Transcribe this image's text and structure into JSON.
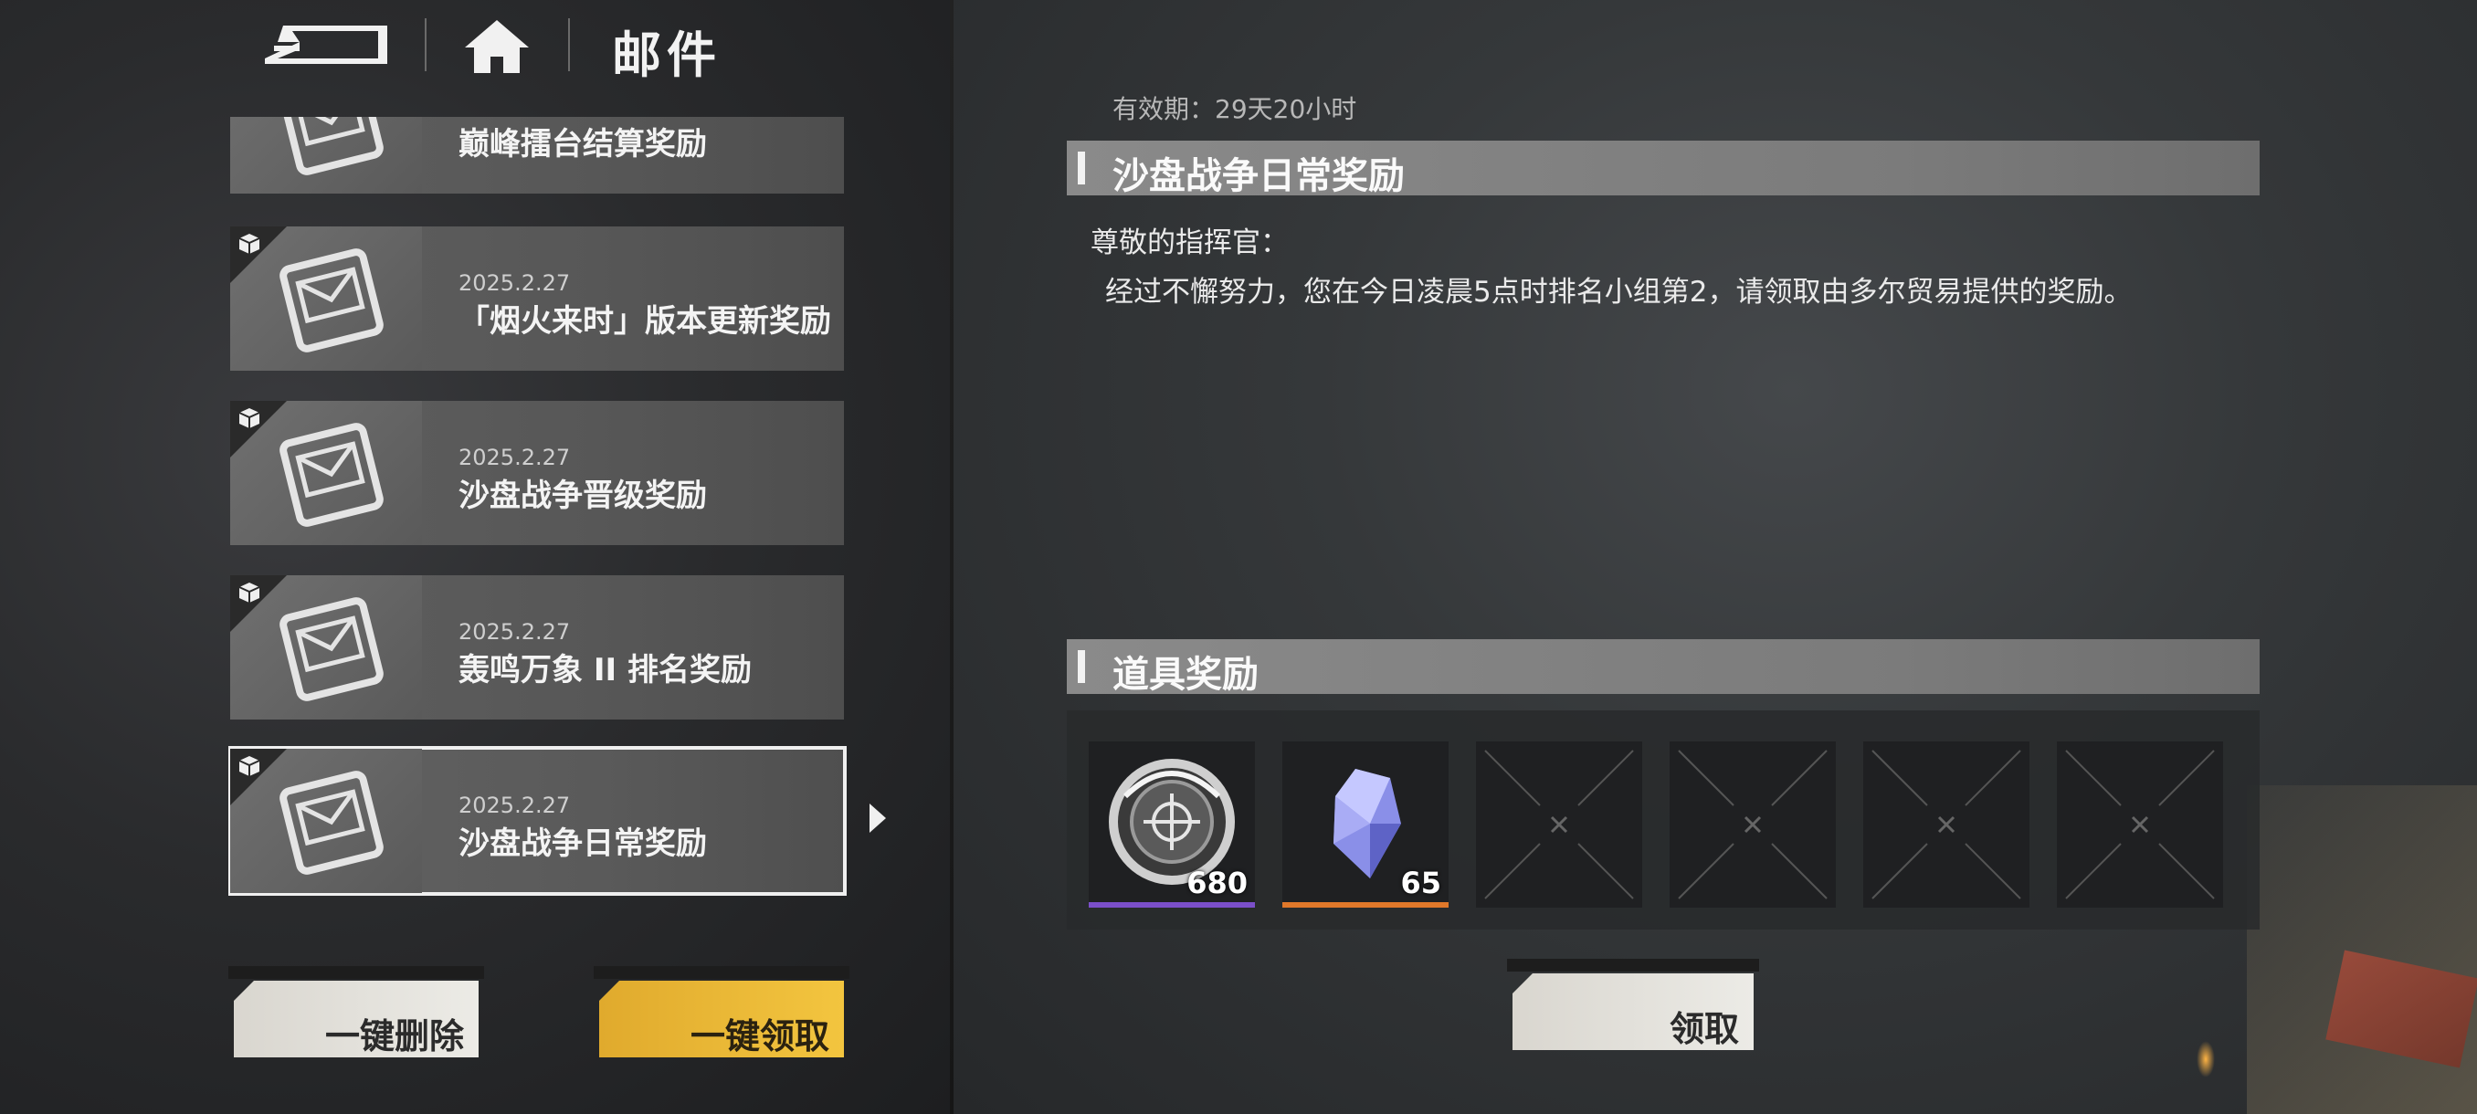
{
  "header": {
    "title": "邮件",
    "back_icon": "back-arrow-icon",
    "home_icon": "home-icon"
  },
  "mail_list": [
    {
      "date": "",
      "subject": "巅峰擂台结算奖励",
      "has_attachment": false,
      "selected": false
    },
    {
      "date": "2025.2.27",
      "subject": "「烟火来时」版本更新奖励",
      "has_attachment": true,
      "selected": false
    },
    {
      "date": "2025.2.27",
      "subject": "沙盘战争晋级奖励",
      "has_attachment": true,
      "selected": false
    },
    {
      "date": "2025.2.27",
      "subject": "轰鸣万象 II 排名奖励",
      "has_attachment": true,
      "selected": false
    },
    {
      "date": "2025.2.27",
      "subject": "沙盘战争日常奖励",
      "has_attachment": true,
      "selected": true
    }
  ],
  "buttons": {
    "delete_all": "一键删除",
    "claim_all": "一键领取",
    "claim": "领取"
  },
  "detail": {
    "expiry": "有效期：29天20小时",
    "title": "沙盘战争日常奖励",
    "greeting": "尊敬的指挥官：",
    "body": "经过不懈努力，您在今日凌晨5点时排名小组第2，请领取由多尔贸易提供的奖励。",
    "rewards_header": "道具奖励",
    "rewards": [
      {
        "icon": "medal-coin-icon",
        "quantity": "680",
        "rarity_color": "#7b4fc9"
      },
      {
        "icon": "crystal-icon",
        "quantity": "65",
        "rarity_color": "#e0782a"
      },
      {
        "icon": "empty-slot-icon",
        "quantity": "",
        "rarity_color": ""
      },
      {
        "icon": "empty-slot-icon",
        "quantity": "",
        "rarity_color": ""
      },
      {
        "icon": "empty-slot-icon",
        "quantity": "",
        "rarity_color": ""
      },
      {
        "icon": "empty-slot-icon",
        "quantity": "",
        "rarity_color": ""
      }
    ]
  },
  "colors": {
    "accent_yellow": "#f0bd3a",
    "button_light": "#e6e4de",
    "header_bar": "#808080"
  }
}
